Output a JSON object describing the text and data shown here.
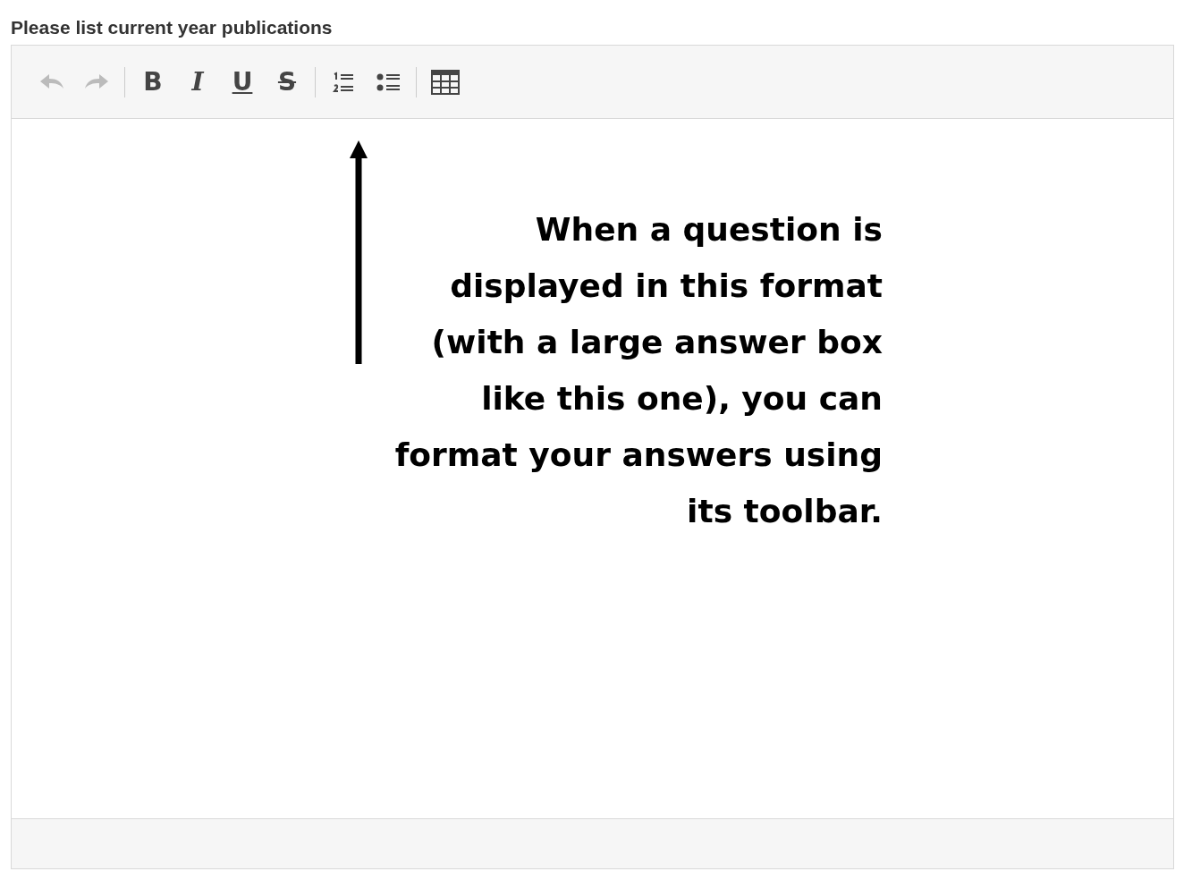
{
  "question": {
    "label": "Please list current year publications"
  },
  "toolbar": {
    "groups": [
      [
        {
          "kind": "undo",
          "disabled": true
        },
        {
          "kind": "redo",
          "disabled": true
        }
      ],
      [
        {
          "kind": "bold",
          "glyph": "B",
          "disabled": false
        },
        {
          "kind": "italic",
          "glyph": "I",
          "disabled": false
        },
        {
          "kind": "underline",
          "glyph": "U",
          "disabled": false
        },
        {
          "kind": "strike",
          "glyph": "S",
          "disabled": false
        }
      ],
      [
        {
          "kind": "ordered-list",
          "disabled": false
        },
        {
          "kind": "bullet-list",
          "disabled": false
        }
      ],
      [
        {
          "kind": "table",
          "disabled": false
        }
      ]
    ]
  },
  "annotation": {
    "text": "When a question is\ndisplayed in this format\n(with a large answer box\nlike this one), you can\nformat your answers using\nits toolbar. "
  }
}
